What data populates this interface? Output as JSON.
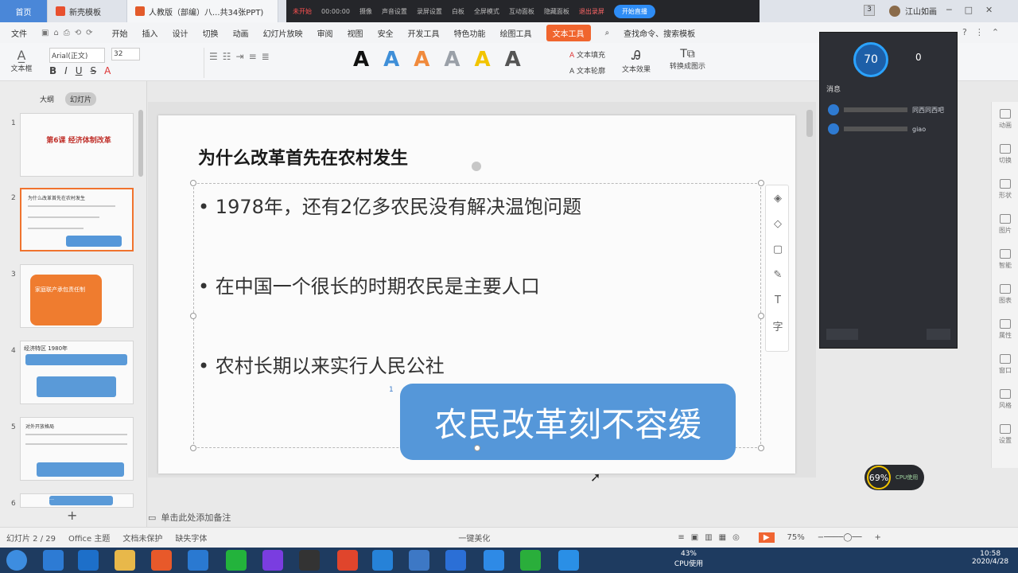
{
  "tabs": [
    {
      "label": "首页"
    },
    {
      "label": "新壳模板"
    },
    {
      "label": "人教版（部编）八...共34张PPT)"
    }
  ],
  "recorder": {
    "status": "未开始",
    "time": "00:00:00",
    "items": [
      "摄像",
      "声音设置",
      "录屏设置",
      "白板",
      "全屏模式",
      "互动面板",
      "隐藏面板",
      "退出录屏"
    ],
    "start_label": "开始直播"
  },
  "user": {
    "name": "江山如画",
    "badge": "3"
  },
  "menu": {
    "file": "文件",
    "items": [
      "开始",
      "插入",
      "设计",
      "切换",
      "动画",
      "幻灯片放映",
      "审阅",
      "视图",
      "安全",
      "开发工具",
      "特色功能",
      "绘图工具",
      "文本工具"
    ],
    "active": "文本工具",
    "search": "查找命令、搜索模板"
  },
  "toolbar": {
    "textbox": "文本框",
    "font": "Arial(正文)",
    "size": "32",
    "fill": "文本填充",
    "outline": "文本轮廓",
    "effect": "文本效果",
    "convert": "转换成图示",
    "styles": [
      {
        "glyph": "A",
        "color": "#111111"
      },
      {
        "glyph": "A",
        "color": "#3f8fd8"
      },
      {
        "glyph": "A",
        "color": "#f08a3c"
      },
      {
        "glyph": "A",
        "color": "#9aa0a8"
      },
      {
        "glyph": "A",
        "color": "#f2c400"
      },
      {
        "glyph": "A",
        "color": "#555555"
      }
    ]
  },
  "thumbs": {
    "tab_outline": "大纲",
    "tab_slides": "幻灯片",
    "items": [
      {
        "num": "1",
        "text": "第6课 经济体制改革"
      },
      {
        "num": "2",
        "text": "为什么改革首先在农村发生"
      },
      {
        "num": "3",
        "text": "家庭联产承包责任制"
      },
      {
        "num": "4",
        "text": "经济特区 1980年"
      },
      {
        "num": "5",
        "text": "对外开放格局"
      },
      {
        "num": "6",
        "text": "…"
      }
    ],
    "add": "+"
  },
  "slide": {
    "title": "为什么改革首先在农村发生",
    "bullets": [
      "1978年，还有2亿多农民没有解决温饱问题",
      "在中国一个很长的时期农民是主要人口",
      "农村长期以来实行人民公社"
    ],
    "callout": "农民改革刻不容缓",
    "callout_index": "1"
  },
  "live": {
    "percent": "70",
    "count": "0",
    "caption": "消息",
    "msgs": [
      "同西同西吧",
      "giao"
    ]
  },
  "side_items": [
    "动画",
    "切换",
    "形状",
    "图片",
    "智能",
    "图表",
    "属性",
    "窗口",
    "风格",
    "设置"
  ],
  "notes": "单击此处添加备注",
  "status": {
    "slide": "幻灯片 2 / 29",
    "theme": "Office 主题",
    "backup": "文档未保护",
    "font": "缺失字体",
    "beautify": "一键美化",
    "zoom": "75%"
  },
  "cpu": {
    "percent": "69%",
    "label": "CPU使用",
    "taskbar_cpu": "43%",
    "taskbar_label": "CPU使用"
  },
  "clock": {
    "time": "10:58",
    "date": "2020/4/28"
  }
}
